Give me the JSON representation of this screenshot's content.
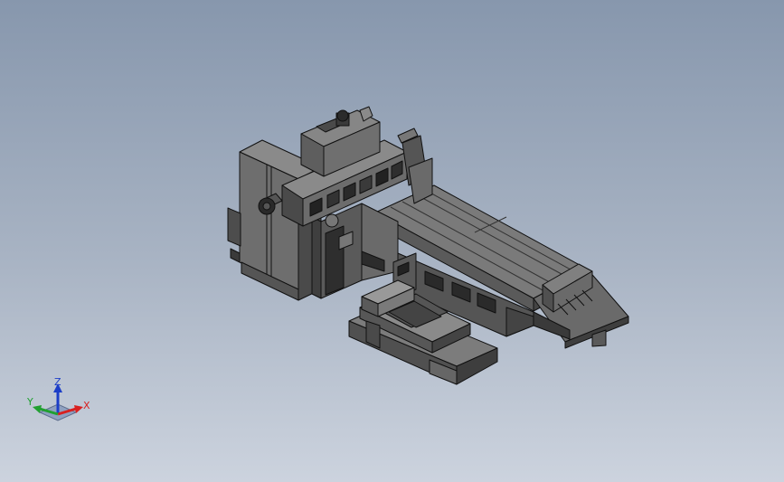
{
  "viewport": {
    "background_top": "#8797ad",
    "background_bottom": "#ccd3de"
  },
  "model": {
    "face_colors": {
      "light": "#7d7d7d",
      "mid": "#5e5e5e",
      "dark": "#404040",
      "edge": "#111111"
    }
  },
  "triad": {
    "x_label": "X",
    "y_label": "Y",
    "z_label": "Z",
    "x_color": "#d82020",
    "y_color": "#20a030",
    "z_color": "#1c3ec8"
  }
}
